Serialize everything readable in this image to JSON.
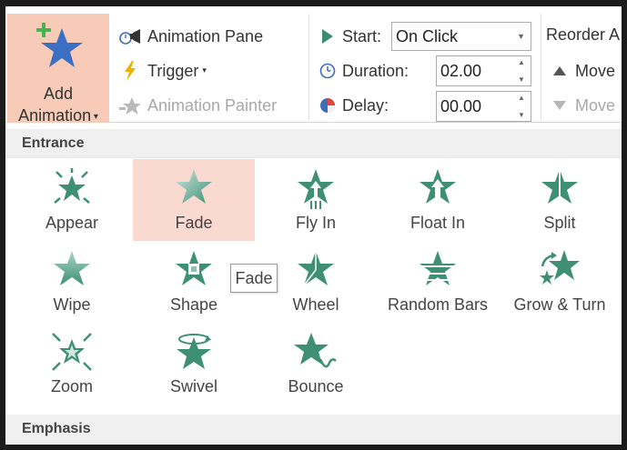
{
  "ribbon": {
    "add_animation": {
      "line1": "Add",
      "line2": "Animation"
    },
    "animation_pane": "Animation Pane",
    "trigger": "Trigger",
    "animation_painter": "Animation Painter",
    "start_label": "Start:",
    "start_value": "On Click",
    "duration_label": "Duration:",
    "duration_value": "02.00",
    "delay_label": "Delay:",
    "delay_value": "00.00",
    "reorder_label": "Reorder A",
    "move_earlier": "Move",
    "move_later": "Move"
  },
  "gallery": {
    "entrance_header": "Entrance",
    "emphasis_header": "Emphasis",
    "effects": [
      {
        "label": "Appear",
        "icon": "appear-star-icon",
        "selected": false
      },
      {
        "label": "Fade",
        "icon": "fade-star-icon",
        "selected": true
      },
      {
        "label": "Fly In",
        "icon": "fly-in-star-icon",
        "selected": false
      },
      {
        "label": "Float In",
        "icon": "float-in-star-icon",
        "selected": false
      },
      {
        "label": "Split",
        "icon": "split-star-icon",
        "selected": false
      },
      {
        "label": "Wipe",
        "icon": "wipe-star-icon",
        "selected": false
      },
      {
        "label": "Shape",
        "icon": "shape-star-icon",
        "selected": false
      },
      {
        "label": "Wheel",
        "icon": "wheel-star-icon",
        "selected": false
      },
      {
        "label": "Random Bars",
        "icon": "random-bars-star-icon",
        "selected": false
      },
      {
        "label": "Grow & Turn",
        "icon": "grow-turn-star-icon",
        "selected": false
      },
      {
        "label": "Zoom",
        "icon": "zoom-star-icon",
        "selected": false
      },
      {
        "label": "Swivel",
        "icon": "swivel-star-icon",
        "selected": false
      },
      {
        "label": "Bounce",
        "icon": "bounce-star-icon",
        "selected": false
      }
    ],
    "tooltip": "Fade"
  },
  "colors": {
    "star_green": "#3e8f74",
    "selected_bg": "#fadad0",
    "add_animation_bg": "#f8cbb8",
    "header_bg": "#f0f0f0"
  }
}
